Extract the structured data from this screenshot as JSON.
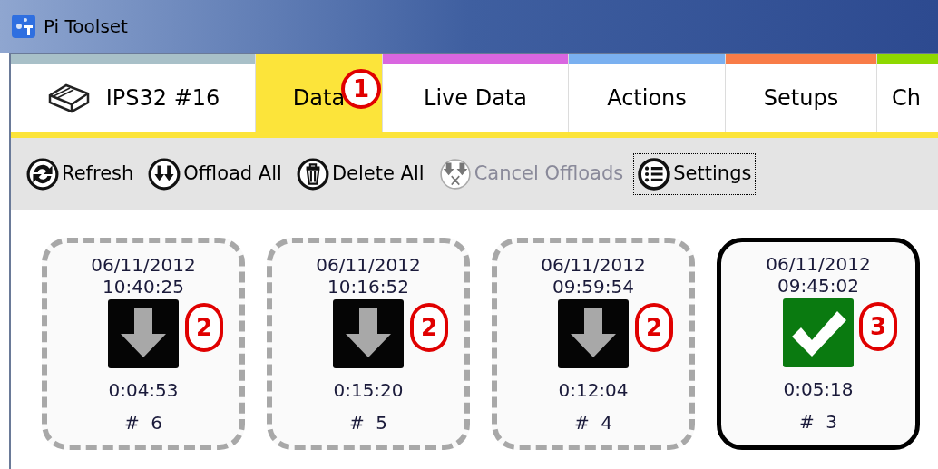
{
  "window": {
    "title": "Pi Toolset"
  },
  "tabs": [
    {
      "label": "IPS32 #16",
      "kind": "device",
      "color": "#a8c0c8",
      "selected": false
    },
    {
      "label": "Data",
      "kind": "plain",
      "color": "#fce43a",
      "selected": true,
      "callout": "1"
    },
    {
      "label": "Live Data",
      "kind": "plain",
      "color": "#d966e0",
      "selected": false
    },
    {
      "label": "Actions",
      "kind": "plain",
      "color": "#7ab0f0",
      "selected": false
    },
    {
      "label": "Setups",
      "kind": "plain",
      "color": "#f87c48",
      "selected": false
    },
    {
      "label": "Ch",
      "kind": "plain",
      "color": "#8ed800",
      "selected": false
    }
  ],
  "toolbar": [
    {
      "label": "Refresh",
      "kind": "refresh",
      "disabled": false,
      "focused": false
    },
    {
      "label": "Offload All",
      "kind": "offload",
      "disabled": false,
      "focused": false
    },
    {
      "label": "Delete All",
      "kind": "delete",
      "disabled": false,
      "focused": false
    },
    {
      "label": "Cancel Offloads",
      "kind": "cancel",
      "disabled": true,
      "focused": false
    },
    {
      "label": "Settings",
      "kind": "settings",
      "disabled": false,
      "focused": true
    }
  ],
  "records": [
    {
      "date": "06/11/2012",
      "time": "10:40:25",
      "duration": "0:04:53",
      "number": "#  6",
      "kind": "pending",
      "selected": false,
      "callout": "2"
    },
    {
      "date": "06/11/2012",
      "time": "10:16:52",
      "duration": "0:15:20",
      "number": "#  5",
      "kind": "pending",
      "selected": false,
      "callout": "2"
    },
    {
      "date": "06/11/2012",
      "time": "09:59:54",
      "duration": "0:12:04",
      "number": "#  4",
      "kind": "pending",
      "selected": false,
      "callout": "2"
    },
    {
      "date": "06/11/2012",
      "time": "09:45:02",
      "duration": "0:05:18",
      "number": "#  3",
      "kind": "done",
      "selected": true,
      "callout": "3"
    }
  ]
}
